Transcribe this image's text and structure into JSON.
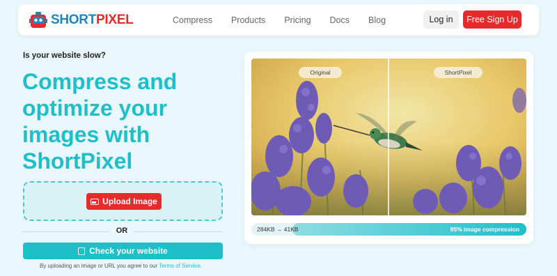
{
  "brand": {
    "part1": "SHORT",
    "part2": "PIXEL"
  },
  "nav": {
    "links": [
      "Compress",
      "Products",
      "Pricing",
      "Docs",
      "Blog"
    ]
  },
  "auth": {
    "login_label": "Log in",
    "signup_label": "Free Sign Up"
  },
  "hero": {
    "eyebrow": "Is your website slow?",
    "headline_lines": [
      "Compress and",
      "optimize your",
      "images with",
      "ShortPixel"
    ]
  },
  "upload": {
    "button_label": "Upload Image",
    "or_label": "OR"
  },
  "check": {
    "button_label": "Check your website"
  },
  "terms": {
    "text": "By uploading an image or URL you agree to our",
    "link": "Terms of Service",
    "suffix": "."
  },
  "demo": {
    "original_label": "Original",
    "optimized_label": "ShortPixel",
    "size_before": "284KB",
    "size_arrow": "→",
    "size_after": "41KB",
    "compression_percent": 85,
    "compression_label": "85% image compression"
  },
  "colors": {
    "brand_teal": "#1fbfca",
    "brand_red": "#e52b2b",
    "brand_blue": "#1f86c2"
  },
  "icons": {
    "upload": "image-icon",
    "check": "clipboard-icon",
    "logo": "robot-logo-icon"
  }
}
